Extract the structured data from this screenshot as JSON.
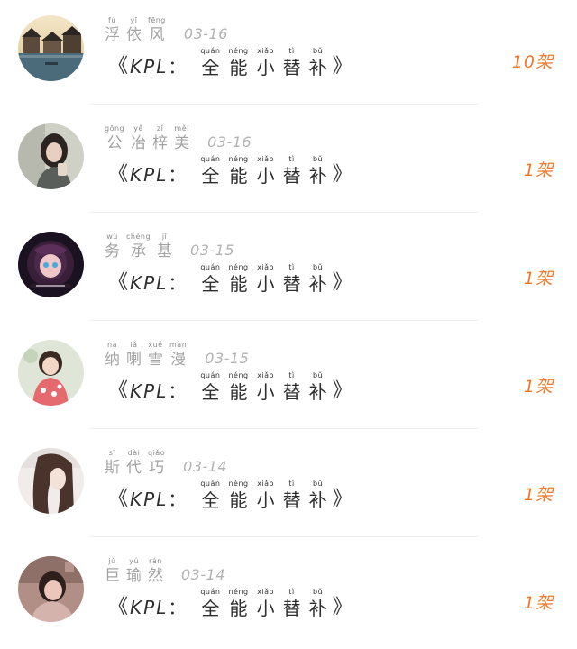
{
  "posts": [
    {
      "name": [
        {
          "py": "fú",
          "hz": "浮"
        },
        {
          "py": "yī",
          "hz": "依"
        },
        {
          "py": "fēng",
          "hz": "风"
        }
      ],
      "date": "03-16",
      "count": "10架",
      "avatar": "water-town-avatar"
    },
    {
      "name": [
        {
          "py": "gōng",
          "hz": "公"
        },
        {
          "py": "yě",
          "hz": "冶"
        },
        {
          "py": "zǐ",
          "hz": "梓"
        },
        {
          "py": "měi",
          "hz": "美"
        }
      ],
      "date": "03-16",
      "count": "1架",
      "avatar": "woman-portrait-avatar"
    },
    {
      "name": [
        {
          "py": "wù",
          "hz": "务"
        },
        {
          "py": "chéng",
          "hz": "承"
        },
        {
          "py": "jī",
          "hz": "基"
        }
      ],
      "date": "03-15",
      "count": "1架",
      "avatar": "anime-girl-avatar"
    },
    {
      "name": [
        {
          "py": "nà",
          "hz": "纳"
        },
        {
          "py": "lǎ",
          "hz": "喇"
        },
        {
          "py": "xuě",
          "hz": "雪"
        },
        {
          "py": "màn",
          "hz": "漫"
        }
      ],
      "date": "03-15",
      "count": "1架",
      "avatar": "child-avatar"
    },
    {
      "name": [
        {
          "py": "sī",
          "hz": "斯"
        },
        {
          "py": "dài",
          "hz": "代"
        },
        {
          "py": "qiǎo",
          "hz": "巧"
        }
      ],
      "date": "03-14",
      "count": "1架",
      "avatar": "woman-hair-avatar"
    },
    {
      "name": [
        {
          "py": "jù",
          "hz": "巨"
        },
        {
          "py": "yú",
          "hz": "瑜"
        },
        {
          "py": "rán",
          "hz": "然"
        }
      ],
      "date": "03-14",
      "count": "1架",
      "avatar": "girl-photo-avatar"
    }
  ],
  "title": {
    "open": "《",
    "kpl": "KPL",
    "colon": "：",
    "chars": [
      {
        "py": "quán",
        "hz": "全"
      },
      {
        "py": "néng",
        "hz": "能"
      },
      {
        "py": "xiǎo",
        "hz": "小"
      },
      {
        "py": "tì",
        "hz": "替"
      },
      {
        "py": "bǔ",
        "hz": "补"
      }
    ],
    "close": "》"
  },
  "colors": {
    "accent": "#f07a2c",
    "name_text": "#a3a3a3",
    "title_text": "#2e2e2e"
  }
}
